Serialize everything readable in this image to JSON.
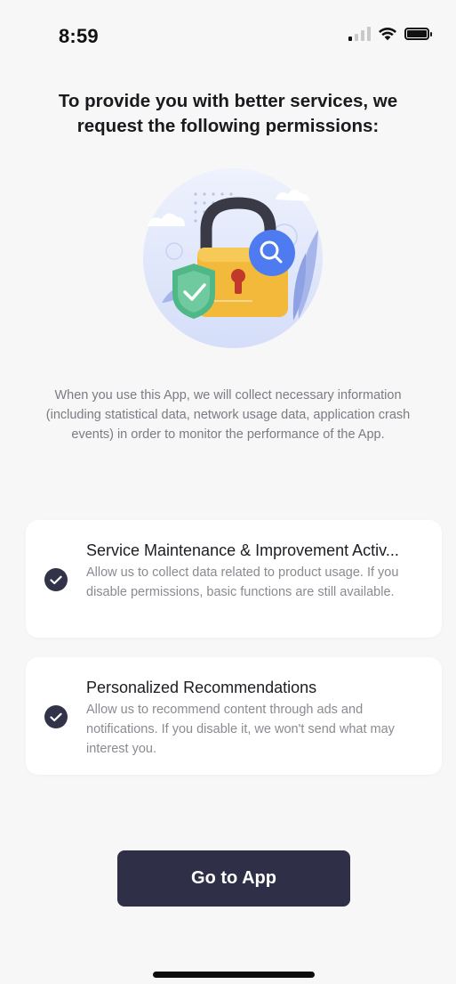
{
  "status_bar": {
    "time": "8:59",
    "signal_icon": "cellular-signal-icon",
    "wifi_icon": "wifi-icon",
    "battery_icon": "battery-icon"
  },
  "headline": "To provide you with better services, we request the following permissions:",
  "illustration": {
    "icon": "padlock-shield-search-illustration",
    "colors": {
      "circle": "#dce4fb",
      "lock_body": "#f2b93b",
      "shield": "#4fb886",
      "search_badge": "#4e7cf0",
      "shackle": "#3a3a46"
    }
  },
  "intro_text": "When you use this App, we will collect necessary information (including statistical data, network usage data, application crash events) in order to monitor the performance of the App.",
  "permissions": [
    {
      "title": "Service Maintenance & Improvement Activ...",
      "description": "Allow us to collect data related to product usage. If you disable permissions, basic functions are still available.",
      "checked": true,
      "icon": "check-circle-icon"
    },
    {
      "title": "Personalized Recommendations",
      "description": "Allow us to recommend content through ads and notifications. If you disable it, we won't send what may interest you.",
      "checked": true,
      "icon": "check-circle-icon"
    }
  ],
  "primary_button": {
    "label": "Go to App"
  },
  "colors": {
    "accent": "#2f2f47",
    "background": "#f7f7f8",
    "card": "#ffffff",
    "muted_text": "#8a8a91"
  }
}
